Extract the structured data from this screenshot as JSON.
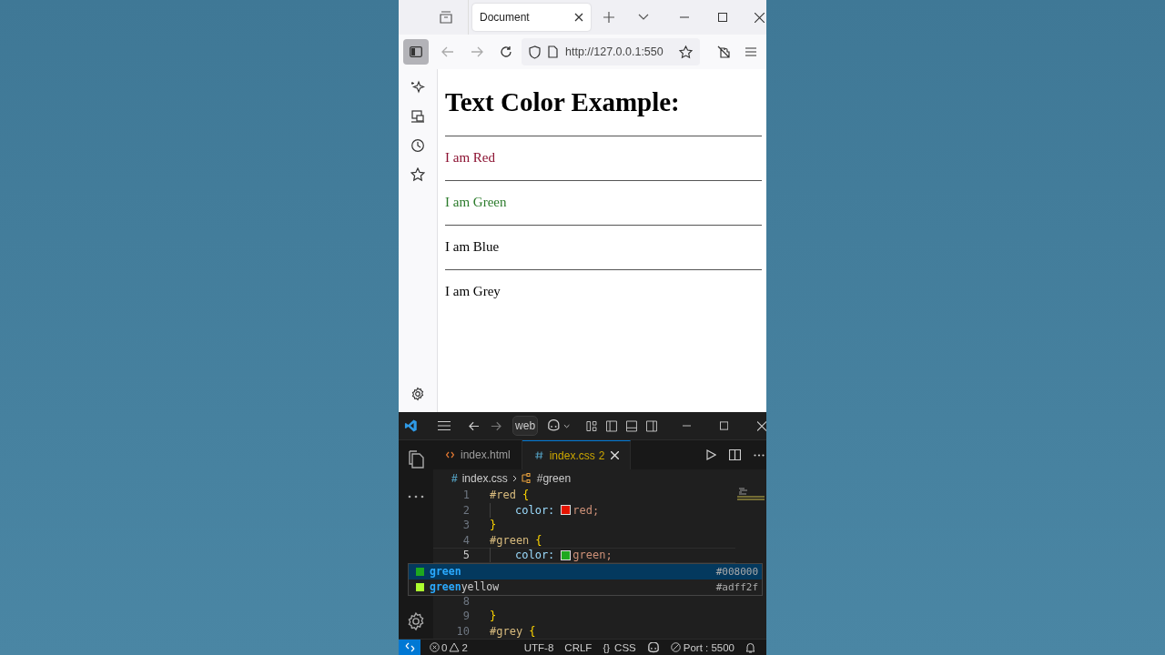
{
  "browser": {
    "tabs": [
      {
        "label": "Document",
        "selected": true
      }
    ],
    "url": "http://127.0.0.1:550",
    "page": {
      "heading": "Text Color Example:",
      "items": [
        {
          "text": "I am Red",
          "color": "#8b1030"
        },
        {
          "text": "I am Green",
          "color": "#2a7a2a"
        },
        {
          "text": "I am Blue",
          "color": "#000000"
        },
        {
          "text": "I am Grey",
          "color": "#000000"
        }
      ]
    }
  },
  "editor": {
    "search": "web",
    "tabs": [
      {
        "label": "index.html",
        "kind": "html",
        "selected": false
      },
      {
        "label": "index.css",
        "problems": "2",
        "kind": "css",
        "selected": true
      }
    ],
    "breadcrumb": {
      "file_icon": "#",
      "file": "index.css",
      "symbol": "#green"
    },
    "lines": [
      {
        "number": "1",
        "indented": false,
        "current": false,
        "tokens": [
          {
            "kind": "selector",
            "text": "#red"
          },
          {
            "kind": "brace",
            "text": "{"
          }
        ]
      },
      {
        "number": "2",
        "indented": true,
        "current": false,
        "tokens": [
          {
            "kind": "property",
            "text": "color:"
          },
          {
            "kind": "swatch",
            "color": "#e51400"
          },
          {
            "kind": "value",
            "text": "red;"
          }
        ]
      },
      {
        "number": "3",
        "indented": false,
        "current": false,
        "tokens": [
          {
            "kind": "brace",
            "text": "}"
          }
        ]
      },
      {
        "number": "4",
        "indented": false,
        "current": false,
        "tokens": [
          {
            "kind": "selector",
            "text": "#green"
          },
          {
            "kind": "brace",
            "text": "{"
          }
        ]
      },
      {
        "number": "5",
        "indented": true,
        "current": true,
        "tokens": [
          {
            "kind": "property",
            "text": "color:"
          },
          {
            "kind": "swatch",
            "color": "#1ea81e"
          },
          {
            "kind": "value",
            "text": "green;"
          }
        ]
      },
      {
        "number": "8",
        "indented": false,
        "current": false
      },
      {
        "number": "9",
        "indented": false,
        "current": false,
        "tokens": [
          {
            "kind": "brace",
            "text": "}"
          }
        ]
      },
      {
        "number": "10",
        "indented": false,
        "current": false,
        "tokens": [
          {
            "kind": "selector",
            "text": "#grey"
          },
          {
            "kind": "brace",
            "text": "{"
          }
        ]
      }
    ],
    "suggestions": [
      {
        "match": "green",
        "hex": "#008000",
        "color": "#1ea81e",
        "selected": true
      },
      {
        "match": "green",
        "rest": "yellow",
        "hex": "#adff2f",
        "color": "#adff2f",
        "selected": false
      }
    ],
    "status": {
      "errors": "0",
      "warnings": "2",
      "encoding": "UTF-8",
      "eol": "CRLF",
      "language_icon": "{}",
      "language": "CSS",
      "port": "Port : 5500"
    }
  }
}
